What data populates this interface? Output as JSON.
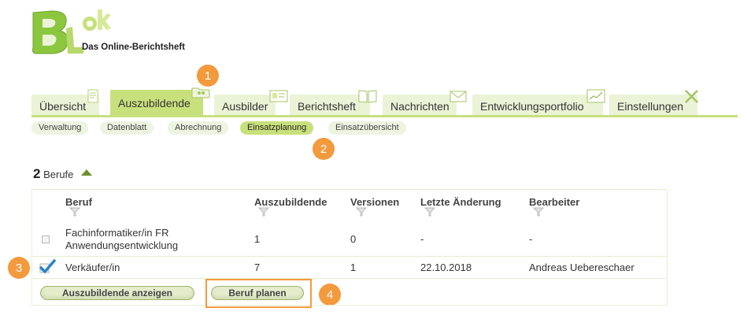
{
  "brand": {
    "logo_alt": "BLok",
    "subtitle": "Das Online-Berichtsheft",
    "colors": {
      "accent": "#c8e07c",
      "tab_bg": "#eaf3d6",
      "callout": "#f39a3d",
      "logo_green": "#8cc63f"
    }
  },
  "callouts": [
    "1",
    "2",
    "3",
    "4"
  ],
  "tabs": [
    {
      "label": "Übersicht",
      "icon": "document-icon",
      "active": false
    },
    {
      "label": "Auszubildende",
      "icon": "folder-people-icon",
      "active": true
    },
    {
      "label": "Ausbilder",
      "icon": "id-card-icon",
      "active": false
    },
    {
      "label": "Berichtsheft",
      "icon": "book-icon",
      "active": false
    },
    {
      "label": "Nachrichten",
      "icon": "envelope-icon",
      "active": false
    },
    {
      "label": "Entwicklungsportfolio",
      "icon": "chart-icon",
      "active": false
    },
    {
      "label": "Einstellungen",
      "icon": "tools-icon",
      "active": false
    }
  ],
  "subnav": [
    {
      "label": "Verwaltung",
      "active": false
    },
    {
      "label": "Datenblatt",
      "active": false
    },
    {
      "label": "Abrechnung",
      "active": false
    },
    {
      "label": "Einsatzplanung",
      "active": true
    },
    {
      "label": "Einsatzübersicht",
      "active": false
    }
  ],
  "list": {
    "count": "2",
    "count_label": "Berufe",
    "columns": [
      "Beruf",
      "Auszubildende",
      "Versionen",
      "Letzte Änderung",
      "Bearbeiter"
    ],
    "rows": [
      {
        "checked": false,
        "beruf_line1": "Fachinformatiker/in FR",
        "beruf_line2": "Anwendungsentwicklung",
        "azubis": "1",
        "versionen": "0",
        "letzte_aenderung": "-",
        "bearbeiter": "-"
      },
      {
        "checked": true,
        "beruf_line1": "Verkäufer/in",
        "beruf_line2": "",
        "azubis": "7",
        "versionen": "1",
        "letzte_aenderung": "22.10.2018",
        "bearbeiter": "Andreas Uebereschaer"
      }
    ]
  },
  "buttons": {
    "show_trainees": "Auszubildende anzeigen",
    "plan_profession": "Beruf planen"
  }
}
